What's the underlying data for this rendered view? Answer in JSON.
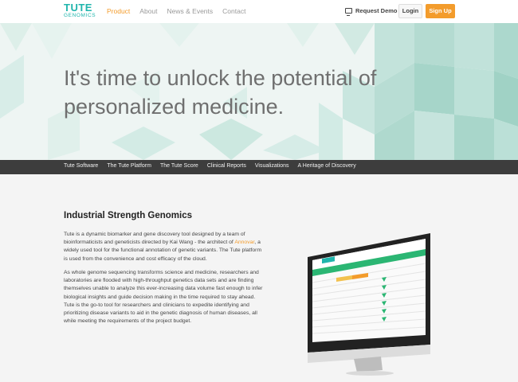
{
  "brand": {
    "line1": "TUTE",
    "line2": "GENOMICS",
    "accent": "#1fb5ac"
  },
  "nav": {
    "items": [
      "Product",
      "About",
      "News & Events",
      "Contact"
    ],
    "active": "Product",
    "request_demo": "Request Demo",
    "login": "Login",
    "signup": "Sign Up"
  },
  "hero": {
    "headline": "It's time to unlock the potential of personalized medicine."
  },
  "subnav": [
    "Tute Software",
    "The Tute Platform",
    "The Tute Score",
    "Clinical Reports",
    "Visualizations",
    "A Heritage of Discovery"
  ],
  "content": {
    "title": "Industrial Strength Genomics",
    "p1_before": "Tute is a dynamic biomarker and gene discovery tool designed by a team of bioinformaticists and geneticists directed by Kai Wang - the architect of ",
    "p1_link": "Annovar",
    "p1_after": ", a widely used tool for the functional annotation of genetic variants. The Tute platform is used from the convenience and cost efficacy of the cloud.",
    "p2": "As whole genome sequencing transforms science and medicine, researchers and laboratories are flooded with high-throughput genetics data sets and are finding themselves unable to analyze this ever-increasing data volume fast enough to infer biological insights and guide decision making in the time required to stay ahead. Tute is the go-to tool for researchers and clinicians to expedite identifying and prioritizing disease variants to aid in the genetic diagnosis of human diseases, all while meeting the requirements of the project budget."
  },
  "colors": {
    "orange": "#f39c2c",
    "subnav_bg": "#3d3d3d",
    "content_bg": "#f4f4f4"
  }
}
